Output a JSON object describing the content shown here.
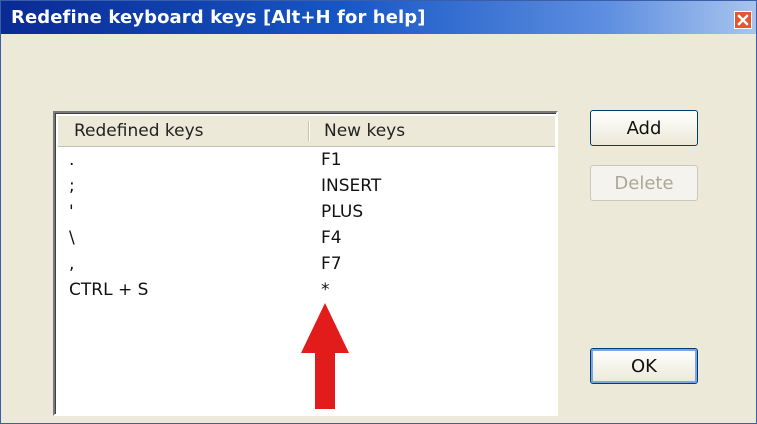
{
  "dialog": {
    "title": "Redefine keyboard keys [Alt+H for help]"
  },
  "columns": {
    "redefined": "Redefined keys",
    "new": "New keys"
  },
  "rows": [
    {
      "redefined": ".",
      "new": "F1"
    },
    {
      "redefined": ";",
      "new": "INSERT"
    },
    {
      "redefined": "'",
      "new": "PLUS"
    },
    {
      "redefined": "\\",
      "new": "F4"
    },
    {
      "redefined": ",",
      "new": "F7"
    },
    {
      "redefined": "CTRL + S",
      "new": "*"
    }
  ],
  "buttons": {
    "add": "Add",
    "delete": "Delete",
    "ok": "OK"
  },
  "annotation": {
    "arrow_color": "#e21b1b"
  }
}
